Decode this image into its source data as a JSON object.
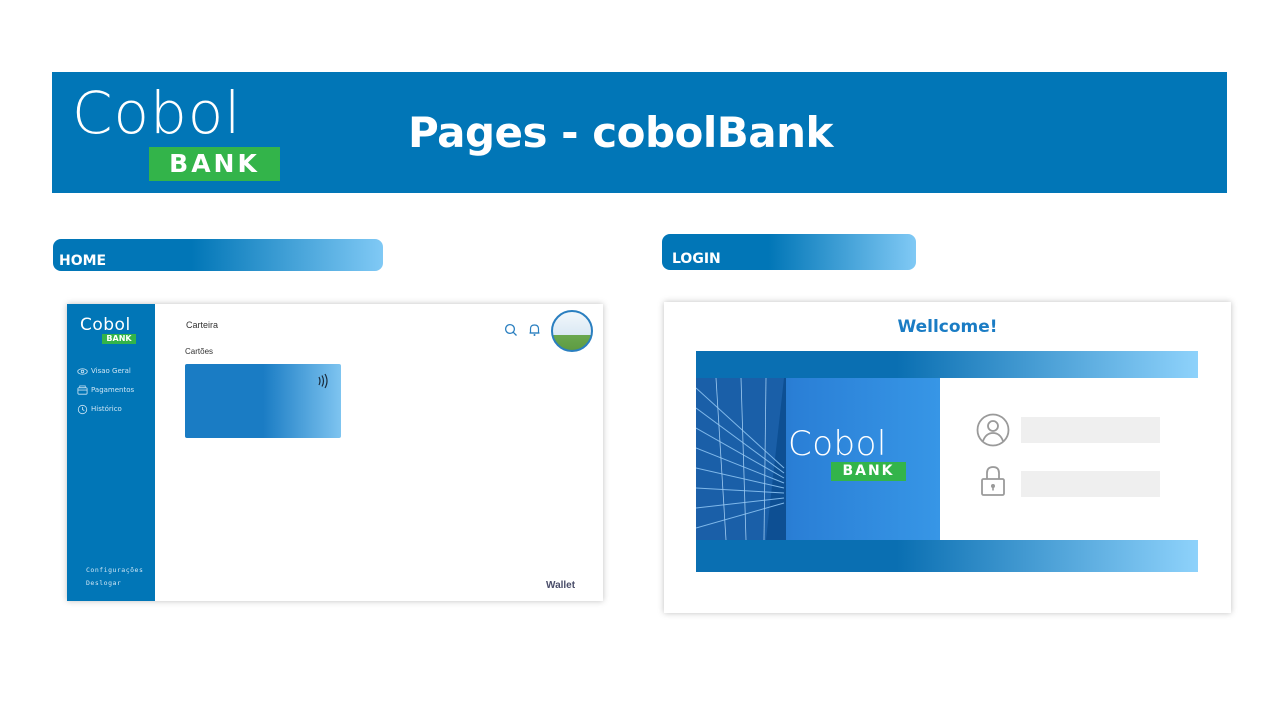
{
  "banner": {
    "logo_word": "Cobol",
    "logo_badge": "BANK",
    "title": "Pages - cobolBank"
  },
  "sections": {
    "home_label": "HOME",
    "login_label": "LOGIN"
  },
  "home": {
    "logo_word": "Cobol",
    "logo_badge": "BANK",
    "nav": [
      {
        "label": "Visao Geral",
        "icon": "eye-icon"
      },
      {
        "label": "Pagamentos",
        "icon": "payments-icon"
      },
      {
        "label": "Histórico",
        "icon": "history-icon"
      }
    ],
    "footer": [
      "Configurações",
      "Deslogar"
    ],
    "title": "Carteira",
    "cards_label": "Cartões",
    "wallet_label": "Wallet",
    "icons": [
      "search-icon",
      "bell-icon",
      "avatar"
    ]
  },
  "login": {
    "welcome": "Wellcome!",
    "logo_word": "Cobol",
    "logo_badge": "BANK",
    "fields": [
      {
        "icon": "user-icon",
        "value": ""
      },
      {
        "icon": "lock-icon",
        "value": ""
      }
    ]
  },
  "colors": {
    "brand_blue": "#0176b7",
    "brand_green": "#33b44a",
    "light_blue": "#80c9f5"
  }
}
